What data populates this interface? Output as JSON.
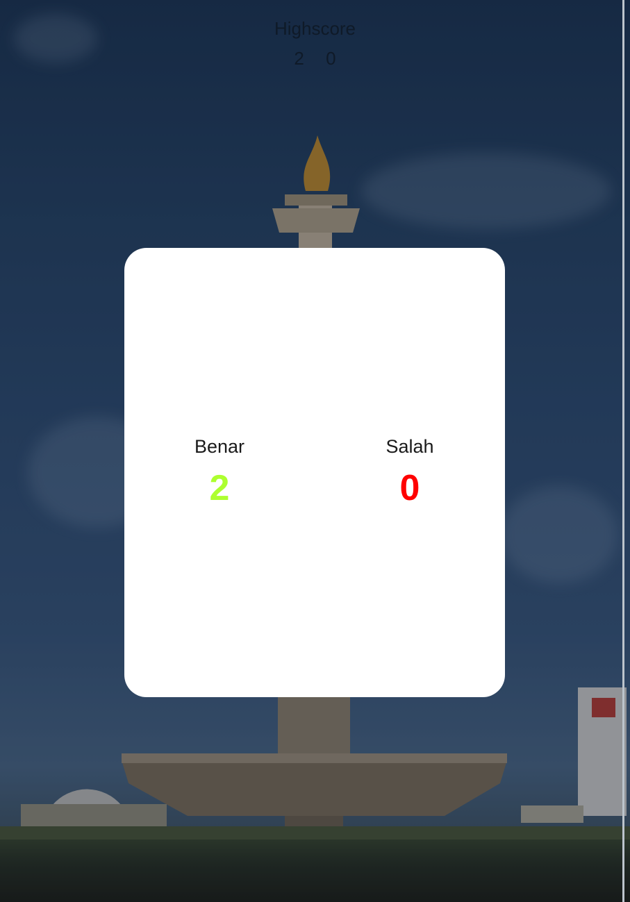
{
  "highscore": {
    "title": "Highscore",
    "correct": "2",
    "wrong": "0"
  },
  "result": {
    "correct_label": "Benar",
    "correct_value": "2",
    "wrong_label": "Salah",
    "wrong_value": "0"
  },
  "colors": {
    "correct": "#adff2f",
    "wrong": "#ff0000"
  }
}
